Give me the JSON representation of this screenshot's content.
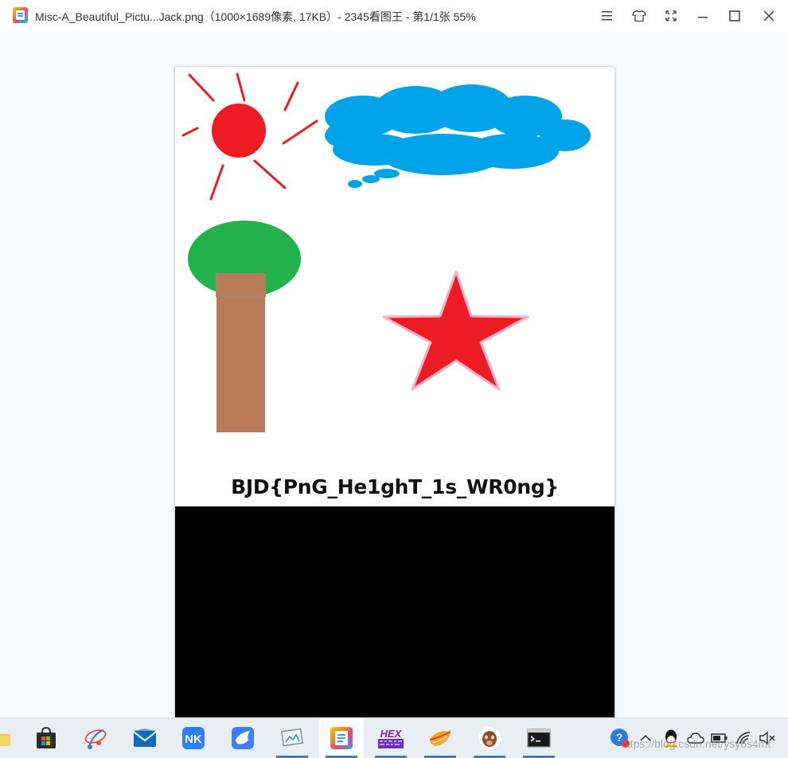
{
  "window": {
    "title": "Misc-A_Beautiful_Pictu...Jack.png（1000×1689像素, 17KB）- 2345看图王 - 第1/1张 55%",
    "controls": [
      "menu-icon",
      "skin-icon",
      "fullscreen-icon",
      "minimize-icon",
      "maximize-icon",
      "close-icon"
    ]
  },
  "image": {
    "flag_text": "BJD{PnG_He1ghT_1s_WR0ng}",
    "colors": {
      "sun": "#ed1c24",
      "cloud": "#00a2e8",
      "tree_top": "#22b14c",
      "trunk": "#b97a57",
      "star": "#ed1c24",
      "star_outline": "#ffaec9",
      "hidden_area": "#000000"
    }
  },
  "taskbar": {
    "apps": [
      {
        "name": "file-explorer",
        "icon": "folder-icon",
        "running": false
      },
      {
        "name": "microsoft-store",
        "icon": "store-icon",
        "running": false
      },
      {
        "name": "xmind",
        "icon": "xmind-icon",
        "running": false
      },
      {
        "name": "mail",
        "icon": "mail-icon",
        "running": false
      },
      {
        "name": "nk-app",
        "icon": "nk-icon",
        "running": false
      },
      {
        "name": "feishu",
        "icon": "bird-icon",
        "running": false
      },
      {
        "name": "image-tool",
        "icon": "screenshot-icon",
        "running": true
      },
      {
        "name": "2345-viewer",
        "icon": "viewer-icon",
        "running": true,
        "active": true
      },
      {
        "name": "hex-editor",
        "icon": "hex-icon",
        "running": true
      },
      {
        "name": "sticky-app",
        "icon": "leaf-icon",
        "running": true
      },
      {
        "name": "stegsolve",
        "icon": "mascot-icon",
        "running": true
      },
      {
        "name": "terminal",
        "icon": "terminal-icon",
        "running": true
      }
    ],
    "hex_label": "HEX",
    "tray": [
      "help-icon",
      "chevron-up-icon",
      "qq-icon",
      "cloud-icon",
      "battery-icon",
      "wifi-icon",
      "volume-muted-icon"
    ],
    "watermark": "https://blog.csdn.net/ysy6s4mt"
  }
}
